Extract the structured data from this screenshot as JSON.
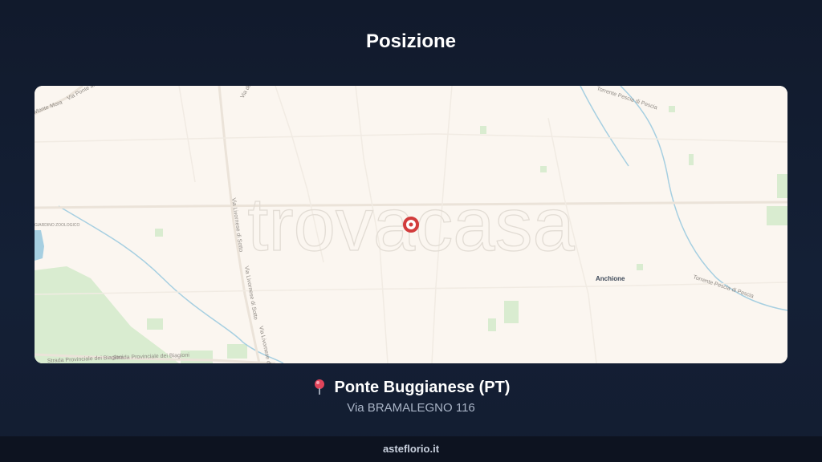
{
  "header": {
    "title": "Posizione"
  },
  "map": {
    "watermark": "trovacasa",
    "roads": {
      "via_livornese_1": "Via Livornese di Sotto",
      "via_livornese_2": "Via Livornese di Sotto",
      "via_livornese_3": "Via Livornese di Sotto",
      "strada_biagioni_1": "Strada Provinciale dei Biagioni",
      "strada_biagioni_2": "Strada Provinciale dei Biagioni",
      "via_ponte": "Via Ponte alla Gora",
      "via_top": "Via dei",
      "via_morte": "Monte Mora",
      "torrente": "Torrente Pescia di Pescia",
      "torrente_top": "Torrente Pescia di Pescia",
      "giardino": "GIARDINO ZOOLOGICO"
    },
    "places": {
      "anchione": "Anchione"
    },
    "marker": "location-marker",
    "colors": {
      "land": "#fbf6f0",
      "park": "#d9ecd0",
      "water": "#a6cfe1",
      "marker": "#d23c3c"
    }
  },
  "location": {
    "pin_icon": "round-pushpin-icon",
    "name": "Ponte Buggianese (PT)",
    "address": "Via BRAMALEGNO 116"
  },
  "footer": {
    "brand": "asteflorio.it"
  }
}
